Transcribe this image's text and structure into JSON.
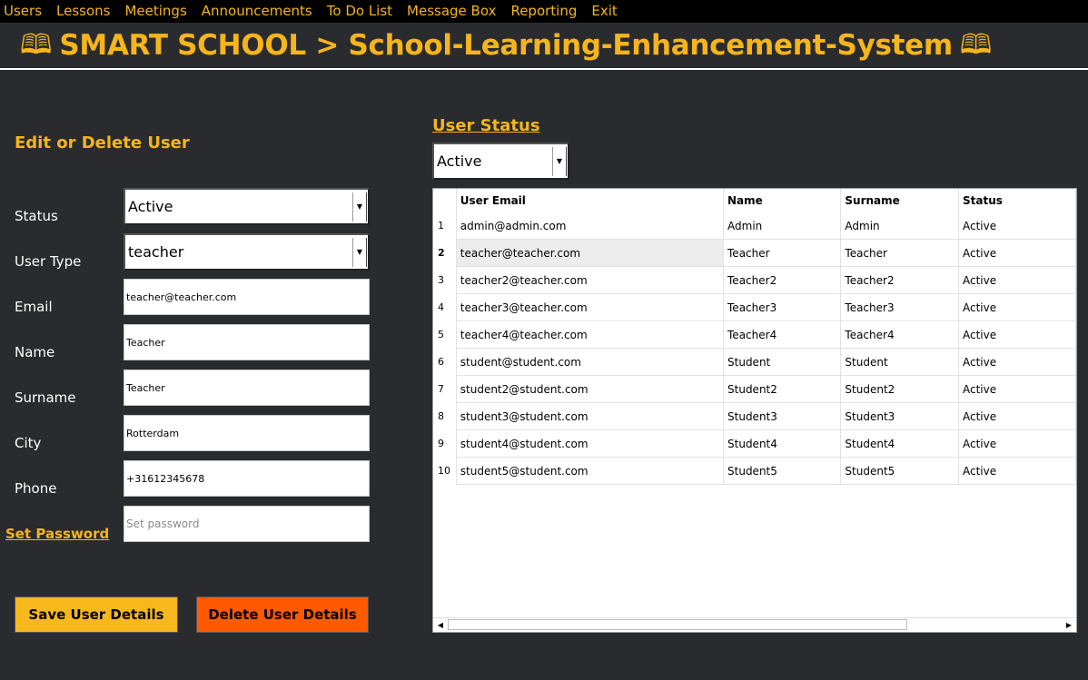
{
  "menu": {
    "items": [
      "Users",
      "Lessons",
      "Meetings",
      "Announcements",
      "To Do List",
      "Message Box",
      "Reporting",
      "Exit"
    ]
  },
  "header": {
    "title": "SMART SCHOOL > School-Learning-Enhancement-System",
    "icon": "book-icon"
  },
  "edit_panel": {
    "title": "Edit or Delete User",
    "status_label": "Status",
    "status_value": "Active",
    "user_type_label": "User Type",
    "user_type_value": "teacher",
    "email_label": "Email",
    "email_value": "teacher@teacher.com",
    "name_label": "Name",
    "name_value": "Teacher",
    "surname_label": "Surname",
    "surname_value": "Teacher",
    "city_label": "City",
    "city_value": "Rotterdam",
    "phone_label": "Phone",
    "phone_value": "+31612345678",
    "set_password_label": "Set Password",
    "password_placeholder": "Set password",
    "save_button": "Save User Details",
    "delete_button": "Delete User Details"
  },
  "user_status": {
    "title": "User Status",
    "filter_value": "Active"
  },
  "table": {
    "columns": [
      "User Email",
      "Name",
      "Surname",
      "Status"
    ],
    "selected_row": 2,
    "rows": [
      {
        "num": "1",
        "email": "admin@admin.com",
        "name": "Admin",
        "surname": "Admin",
        "status": "Active"
      },
      {
        "num": "2",
        "email": "teacher@teacher.com",
        "name": "Teacher",
        "surname": "Teacher",
        "status": "Active"
      },
      {
        "num": "3",
        "email": "teacher2@teacher.com",
        "name": "Teacher2",
        "surname": "Teacher2",
        "status": "Active"
      },
      {
        "num": "4",
        "email": "teacher3@teacher.com",
        "name": "Teacher3",
        "surname": "Teacher3",
        "status": "Active"
      },
      {
        "num": "5",
        "email": "teacher4@teacher.com",
        "name": "Teacher4",
        "surname": "Teacher4",
        "status": "Active"
      },
      {
        "num": "6",
        "email": "student@student.com",
        "name": "Student",
        "surname": "Student",
        "status": "Active"
      },
      {
        "num": "7",
        "email": "student2@student.com",
        "name": "Student2",
        "surname": "Student2",
        "status": "Active"
      },
      {
        "num": "8",
        "email": "student3@student.com",
        "name": "Student3",
        "surname": "Student3",
        "status": "Active"
      },
      {
        "num": "9",
        "email": "student4@student.com",
        "name": "Student4",
        "surname": "Student4",
        "status": "Active"
      },
      {
        "num": "10",
        "email": "student5@student.com",
        "name": "Student5",
        "surname": "Student5",
        "status": "Active"
      }
    ]
  },
  "colors": {
    "accent": "#f5b51b",
    "save_button_bg": "#f7b81c",
    "delete_button_bg": "#ff5a00",
    "background": "#2a2b2f",
    "menubar": "#000000"
  }
}
